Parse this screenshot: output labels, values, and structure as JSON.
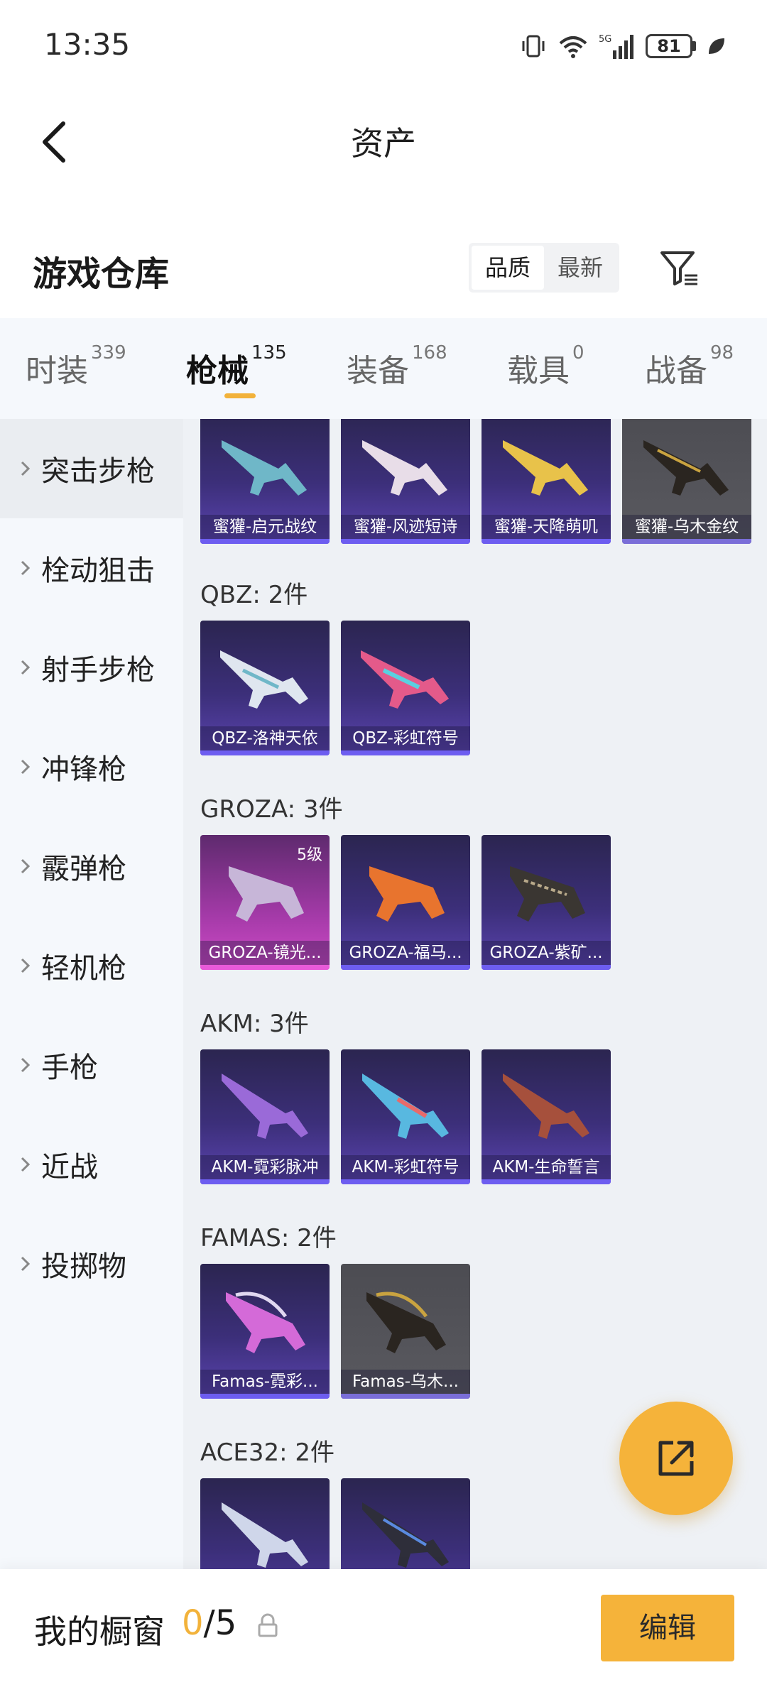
{
  "status_bar": {
    "time": "13:35",
    "network": "5G",
    "battery": "81"
  },
  "nav": {
    "title": "资产"
  },
  "header": {
    "title": "游戏仓库",
    "sort_options": [
      "品质",
      "最新"
    ],
    "sort_selected": "品质"
  },
  "tabs": [
    {
      "label": "时装",
      "count": "339"
    },
    {
      "label": "枪械",
      "count": "135"
    },
    {
      "label": "装备",
      "count": "168"
    },
    {
      "label": "载具",
      "count": "0"
    },
    {
      "label": "战备",
      "count": "98"
    }
  ],
  "active_tab": "枪械",
  "sidebar": {
    "items": [
      "突击步枪",
      "栓动狙击",
      "射手步枪",
      "冲锋枪",
      "霰弹枪",
      "轻机枪",
      "手枪",
      "近战",
      "投掷物"
    ],
    "active": "突击步枪"
  },
  "groups": [
    {
      "title": "",
      "items": [
        "蜜獾-启元战纹",
        "蜜獾-风迹短诗",
        "蜜獾-天降萌叽",
        "蜜獾-乌木金纹"
      ]
    },
    {
      "title": "QBZ: 2件",
      "items": [
        "QBZ-洛神天依",
        "QBZ-彩虹符号"
      ]
    },
    {
      "title": "GROZA: 3件",
      "items": [
        "GROZA-镜光...",
        "GROZA-福马...",
        "GROZA-紫矿..."
      ],
      "level_badge": "5级"
    },
    {
      "title": "AKM: 3件",
      "items": [
        "AKM-霓彩脉冲",
        "AKM-彩虹符号",
        "AKM-生命誓言"
      ]
    },
    {
      "title": "FAMAS: 2件",
      "items": [
        "Famas-霓彩...",
        "Famas-乌木..."
      ]
    },
    {
      "title": "ACE32: 2件",
      "items": [
        "",
        ""
      ]
    }
  ],
  "bottom": {
    "label": "我的橱窗",
    "current": "0",
    "total": "/5",
    "edit_label": "编辑"
  },
  "colors": {
    "accent": "#f5b33a",
    "card_purple": "#3c2f7a",
    "card_pink": "#d04bc8",
    "card_gold": "#5a5a60"
  }
}
